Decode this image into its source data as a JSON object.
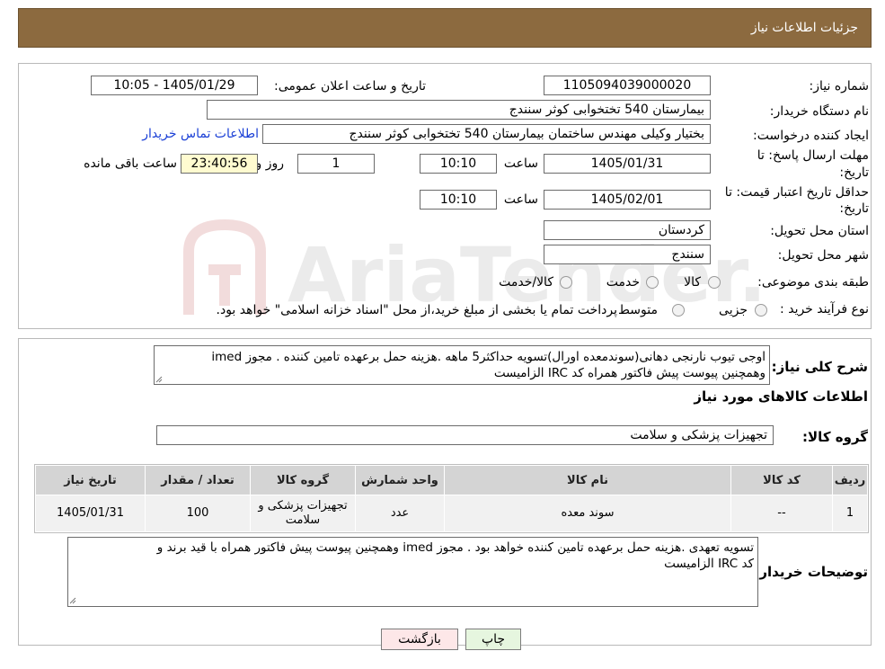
{
  "header": {
    "title": "جزئیات اطلاعات نیاز"
  },
  "form": {
    "need_number": {
      "label": "شماره نیاز:",
      "value": "1105094039000020"
    },
    "announce_datetime": {
      "label": "تاریخ و ساعت اعلان عمومی:",
      "value": "1405/01/29 - 10:05"
    },
    "buyer_org": {
      "label": "نام دستگاه خریدار:",
      "value": "بیمارستان 540 تختخوابی کوثر سنندج"
    },
    "requester": {
      "label": "ایجاد کننده درخواست:",
      "value": "بختیار وکیلی مهندس ساختمان بیمارستان 540 تختخوابی کوثر سنندج",
      "contact_link": "اطلاعات تماس خریدار"
    },
    "deadline": {
      "label_line1": "مهلت ارسال پاسخ: تا",
      "label_line2": "تاریخ:",
      "date": "1405/01/31",
      "time_label": "ساعت",
      "time": "10:10",
      "days": "1",
      "days_label": "روز و",
      "remaining": "23:40:56",
      "remaining_label": "ساعت باقی مانده"
    },
    "validity": {
      "label_line1": "حداقل تاریخ اعتبار قیمت: تا",
      "label_line2": "تاریخ:",
      "date": "1405/02/01",
      "time_label": "ساعت",
      "time": "10:10"
    },
    "province": {
      "label": "استان محل تحویل:",
      "value": "کردستان"
    },
    "city": {
      "label": "شهر محل تحویل:",
      "value": "سنندج"
    },
    "category": {
      "label": "طبقه بندی موضوعی:",
      "options": [
        "کالا",
        "خدمت",
        "کالا/خدمت"
      ]
    },
    "purchase_type": {
      "label": "نوع فرآیند خرید :",
      "options": [
        "جزیی",
        "متوسط"
      ],
      "note": "پرداخت تمام یا بخشی از مبلغ خرید،از محل \"اسناد خزانه اسلامی\" خواهد بود."
    }
  },
  "description": {
    "label": "شرح کلی نیاز:",
    "line1": "اوجی تیوب نارنجی دهانی(سوندمعده اورال)تسویه حداکثر5 ماهه .هزینه حمل برعهده تامین کننده . مجوز imed",
    "line2": "وهمچنین پیوست پیش فاکتور همراه کد IRC  الزامیست"
  },
  "goods_section": {
    "title": "اطلاعات کالاهای مورد نیاز",
    "group_label": "گروه کالا:",
    "group_value": "تجهیزات پزشکی و سلامت"
  },
  "table": {
    "headers": [
      "ردیف",
      "کد کالا",
      "نام کالا",
      "واحد شمارش",
      "گروه کالا",
      "تعداد / مقدار",
      "تاریخ نیاز"
    ],
    "rows": [
      [
        "1",
        "--",
        "سوند معده",
        "عدد",
        "تجهیزات پزشکی و سلامت",
        "100",
        "1405/01/31"
      ]
    ]
  },
  "buyer_notes": {
    "label": "توضیحات خریدار:",
    "line1": "تسویه تعهدی .هزینه حمل برعهده تامین کننده خواهد بود . مجوز imed وهمچنین پیوست پیش فاکتور همراه  با قید برند و",
    "line2": "کد IRC  الزامیست"
  },
  "buttons": {
    "print": "چاپ",
    "back": "بازگشت"
  },
  "watermark": {
    "text": "AriaTender.neT"
  },
  "colors": {
    "header_bg": "#8c6a3f",
    "link": "#1a3fd6",
    "back_button_bg": "#fde7e8",
    "print_button_bg": "#e6f6df"
  }
}
